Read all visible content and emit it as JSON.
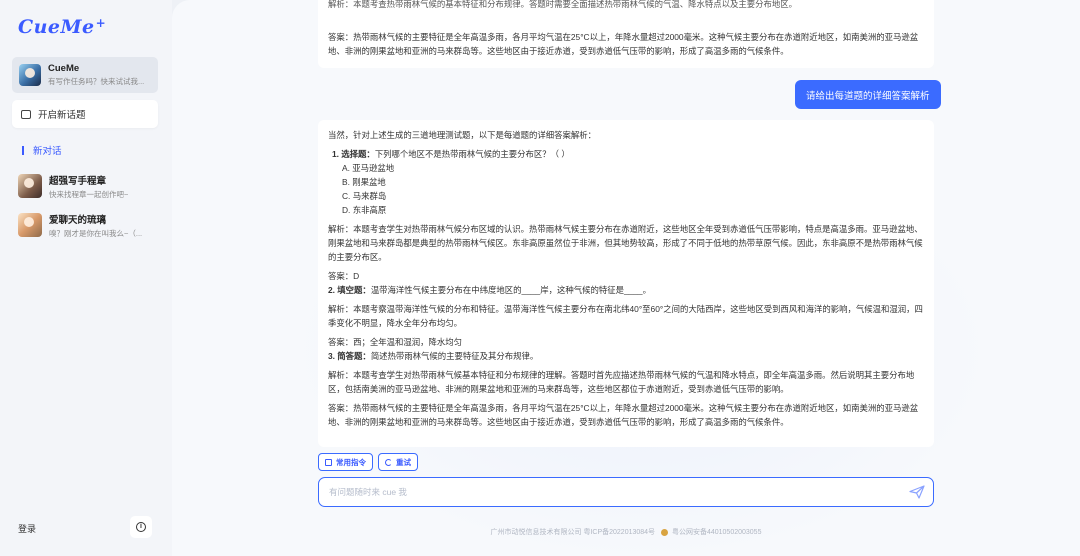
{
  "app": {
    "logo": "CueMe",
    "logo_spark": "+"
  },
  "sidebar": {
    "active_agent": {
      "name": "CueMe",
      "subtitle": "有写作任务吗？快来试试我..."
    },
    "new_topic_label": "开启新话题",
    "new_conversation_label": "新对话",
    "agents": [
      {
        "name": "超强写手程章",
        "subtitle": "快来找程章一起创作吧~"
      },
      {
        "name": "爱聊天的琉璃",
        "subtitle": "嗅？刚才是你在叫我么~（..."
      }
    ],
    "login_label": "登录",
    "info_icon_glyph": "i"
  },
  "chat": {
    "top_card": {
      "clipped_line": "解析：本题考查热带雨林气候的基本特征和分布规律。答题时需要全面描述热带雨林气候的气温、降水特点以及主要分布地区。",
      "answer_line": "答案：热带雨林气候的主要特征是全年高温多雨，各月平均气温在25°C以上，年降水量超过2000毫米。这种气候主要分布在赤道附近地区，如南美洲的亚马逊盆地、非洲的刚果盆地和亚洲的马来群岛等。这些地区由于接近赤道，受到赤道低气压带的影响，形成了高温多雨的气候条件。"
    },
    "user_message": "请给出每道题的详细答案解析",
    "answer": {
      "intro": "当然，针对上述生成的三道地理测试题，以下是每道题的详细答案解析：",
      "q1_label": "1. 选择题：",
      "q1_text": "下列哪个地区不是热带雨林气候的主要分布区？（  ）",
      "q1_options": [
        "A. 亚马逊盆地",
        "B. 刚果盆地",
        "C. 马来群岛",
        "D. 东非高原"
      ],
      "q1_analysis": "解析：本题考查学生对热带雨林气候分布区域的认识。热带雨林气候主要分布在赤道附近，这些地区全年受到赤道低气压带影响，特点是高温多雨。亚马逊盆地、刚果盆地和马来群岛都是典型的热带雨林气候区。东非高原虽然位于非洲，但其地势较高，形成了不同于低地的热带草原气候。因此，东非高原不是热带雨林气候的主要分布区。",
      "q1_answer": "答案：D",
      "q2_label": "2. 填空题：",
      "q2_text": "温带海洋性气候主要分布在中纬度地区的____岸，这种气候的特征是____。",
      "q2_analysis": "解析：本题考察温带海洋性气候的分布和特征。温带海洋性气候主要分布在南北纬40°至60°之间的大陆西岸，这些地区受到西风和海洋的影响，气候温和湿润，四季变化不明显，降水全年分布均匀。",
      "q2_answer": "答案：西；全年温和湿润，降水均匀",
      "q3_label": "3. 简答题：",
      "q3_text": "简述热带雨林气候的主要特征及其分布规律。",
      "q3_analysis": "解析：本题考查学生对热带雨林气候基本特征和分布规律的理解。答题时首先应描述热带雨林气候的气温和降水特点，即全年高温多雨。然后说明其主要分布地区，包括南美洲的亚马逊盆地、非洲的刚果盆地和亚洲的马来群岛等，这些地区都位于赤道附近，受到赤道低气压带的影响。",
      "q3_answer": "答案：热带雨林气候的主要特征是全年高温多雨，各月平均气温在25°C以上，年降水量超过2000毫米。这种气候主要分布在赤道附近地区，如南美洲的亚马逊盆地、非洲的刚果盆地和亚洲的马来群岛等。这些地区由于接近赤道，受到赤道低气压带的影响，形成了高温多雨的气候条件。"
    }
  },
  "toolbar": {
    "common_commands_label": "常用指令",
    "retry_label": "重试"
  },
  "input": {
    "placeholder": "有问题随时来 cue 我",
    "value": ""
  },
  "footer": {
    "company": "广州市动悦信息技术有限公司 粤ICP备2022013084号",
    "police": "粤公网安备44010502003055"
  },
  "colors": {
    "accent": "#3b6bff",
    "logo": "#3b5bff"
  }
}
